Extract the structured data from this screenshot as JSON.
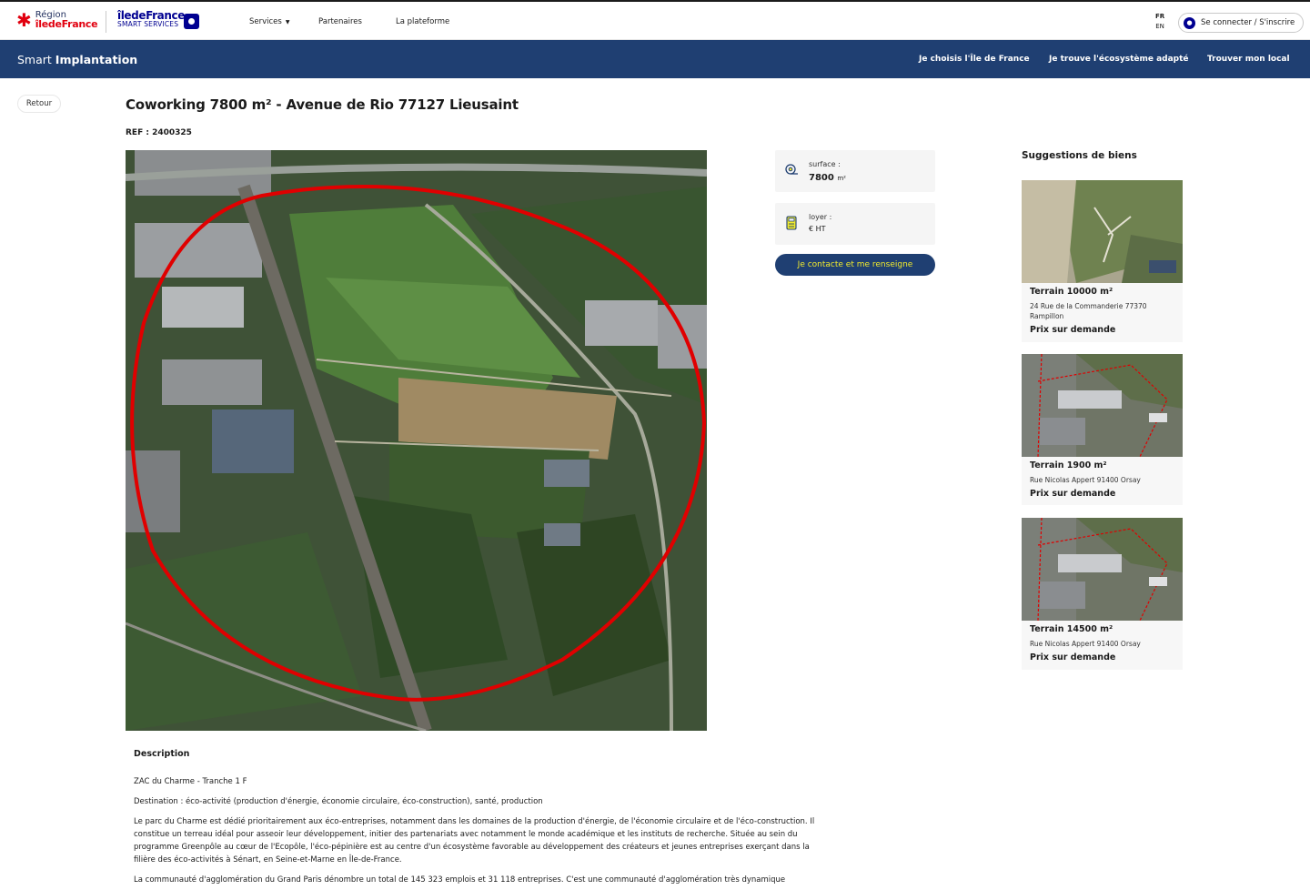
{
  "header": {
    "region_logo": {
      "line1": "Région",
      "line2": "îledeFrance"
    },
    "idf_logo": {
      "line1": "îledeFrance",
      "line2": "SMART SERVICES"
    },
    "nav": [
      {
        "label": "Services"
      },
      {
        "label": "Partenaires"
      },
      {
        "label": "La plateforme"
      }
    ],
    "lang": {
      "fr": "FR",
      "en": "EN"
    },
    "login_label": "Se connecter / S'inscrire"
  },
  "bluebar": {
    "brand_light": "Smart",
    "brand_bold": "Implantation",
    "nav": [
      {
        "label": "Je choisis l'Île de France"
      },
      {
        "label": "Je trouve l'écosystème adapté"
      },
      {
        "label": "Trouver mon local"
      }
    ]
  },
  "back_label": "Retour",
  "listing": {
    "title": "Coworking 7800 m² - Avenue de Rio 77127 Lieusaint",
    "ref": "REF : 2400325",
    "surface_label": "surface :",
    "surface_value": "7800",
    "surface_unit": "m²",
    "rent_label": "loyer :",
    "rent_value": "€ HT",
    "contact_label": "Je contacte et me renseigne"
  },
  "suggestions": {
    "title": "Suggestions de biens",
    "items": [
      {
        "name": "Terrain 10000 m²",
        "address": "24 Rue de la Commanderie 77370 Rampillon",
        "price": "Prix sur demande"
      },
      {
        "name": "Terrain 1900 m²",
        "address": "Rue Nicolas Appert 91400 Orsay",
        "price": "Prix sur demande"
      },
      {
        "name": "Terrain 14500 m²",
        "address": "Rue Nicolas Appert 91400 Orsay",
        "price": "Prix sur demande"
      }
    ]
  },
  "description": {
    "title": "Description",
    "paragraphs": [
      "ZAC du Charme - Tranche 1 F",
      "Destination : éco-activité (production d'énergie, économie circulaire, éco-construction), santé, production",
      "Le parc du Charme est dédié prioritairement aux éco-entreprises, notamment dans les domaines de la production d'énergie, de l'économie circulaire et de l'éco-construction. Il constitue un terreau idéal pour asseoir leur développement, initier des partenariats avec notamment le monde académique et les instituts de recherche. Située au sein du programme Greenpôle au cœur de l'Ecopôle, l'éco-pépinière est au centre d'un écosystème favorable au développement des créateurs et jeunes entreprises exerçant dans la filière des éco-activités à Sénart, en Seine-et-Marne en Île-de-France.",
      "La communauté d'agglomération du Grand Paris dénombre un total de 145 323 emplois et 31 118 entreprises. C'est une communauté d'agglomération très dynamique"
    ]
  },
  "colors": {
    "primary_blue": "#1f3f72",
    "cta_text": "#f1ea2e",
    "region_red": "#e1000f",
    "idf_blue": "#000091"
  }
}
